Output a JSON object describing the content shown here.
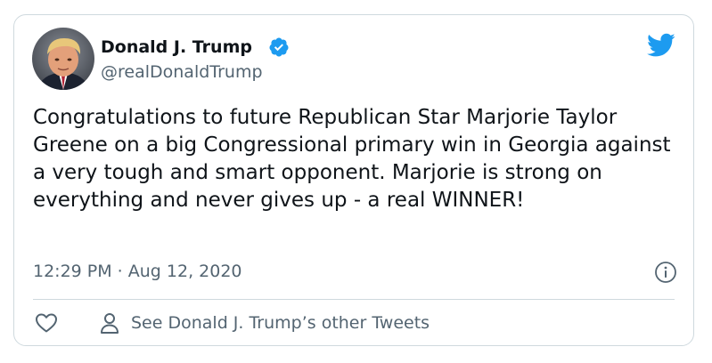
{
  "author": {
    "display_name": "Donald J. Trump",
    "handle": "@realDonaldTrump",
    "verified": true
  },
  "tweet": {
    "text": "Congratulations to future Republican Star Marjorie Taylor Greene on a big Congressional primary win in Georgia against a very tough and smart opponent. Marjorie is strong on everything and never gives up - a real WINNER!",
    "timestamp": "12:29 PM · Aug 12, 2020"
  },
  "actions": {
    "other_tweets_label": "See Donald J. Trump’s other Tweets"
  },
  "icons": {
    "brand": "twitter-bird-icon",
    "verified": "verified-badge-icon",
    "info": "info-icon",
    "like": "heart-icon",
    "profile": "user-icon"
  },
  "colors": {
    "brand_blue": "#1d9bf0",
    "text_primary": "#0f1419",
    "text_secondary": "#536471",
    "border": "#cfd9de"
  }
}
